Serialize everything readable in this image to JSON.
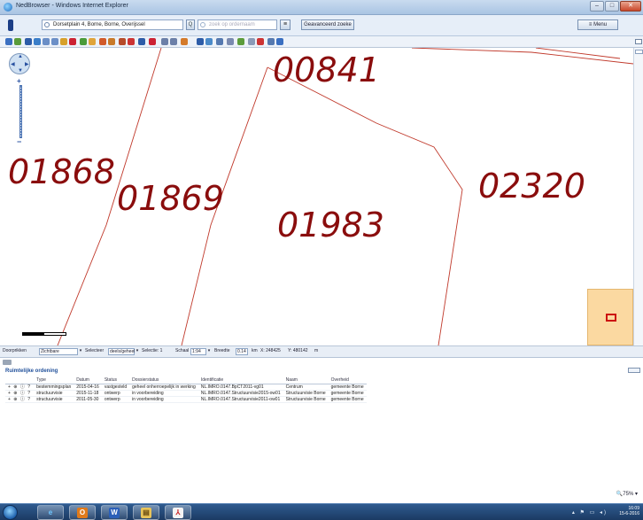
{
  "window": {
    "title": "NedBrowser - Windows Internet Explorer",
    "minimize": "–",
    "maximize": "□",
    "close": "✕"
  },
  "addressbar": {
    "address_value": "Dorsetplain 4, Borne, Borne, Overijssel",
    "search_button": "Q",
    "order_placeholder": "zoek op ordernaam",
    "list_button": "≡",
    "advanced_search": "Geavanceerd zoeke",
    "menu": "≡ Menu"
  },
  "map": {
    "parcels": [
      "00841",
      "01868",
      "01869",
      "01983",
      "02320"
    ],
    "nav_arrows": [
      "▲",
      "◀",
      "▶",
      "▼"
    ],
    "zoom_in": "+",
    "zoom_out": "−"
  },
  "statusbar": {
    "doorprikken_label": "Doorprikken",
    "doorprikken_value": "Zichtbare",
    "selecteer_label": "Selecteer",
    "selecteer_value": "deels/geheel",
    "selectie_label": "Selectie: 1",
    "schaal_label": "Schaal",
    "schaal_value": "1:94",
    "breedte_label": "Breedte",
    "breedte_value": "0.14",
    "unit_km": "km",
    "x_coord": "X: 248425",
    "y_coord": "Y: 480142",
    "unit_m": "m"
  },
  "ordening": {
    "title": "Ruimtelijke ordening",
    "columns": [
      "Type",
      "Datum",
      "Status",
      "Dossierstatus",
      "Identificatie",
      "Naam",
      "Overheid"
    ],
    "rows": [
      [
        "bestemmingsplan",
        "2015-04-16",
        "vastgesteld",
        "geheel onherroepelijk in werking",
        "NL.IMRO.0147.BpCT2011-vg01",
        "Centrum",
        "gemeente Borne"
      ],
      [
        "structuurvisie",
        "2015-11-18",
        "ontwerp",
        "in voorbereiding",
        "NL.IMRO.0147.Structuurvisie2015-ow01",
        "Structuurvisie Borne",
        "gemeente Borne"
      ],
      [
        "structuurvisie",
        "2011-05-30",
        "ontwerp",
        "in voorbereiding",
        "NL.IMRO.0147.Structuurvisie2011-ow01",
        "Structuurvisie Borne",
        "gemeente Borne"
      ]
    ],
    "row_icons": "+ ⊕ ⓘ ?"
  },
  "zoom_level": "🔍75%  ▾",
  "taskbar": {
    "ie_glyph": "e",
    "outlook_glyph": "O",
    "word_glyph": "W",
    "explorer_glyph": "▤",
    "pdf_glyph": "⅄",
    "clock_time": "16:09",
    "clock_date": "15-6-2016",
    "tray": "▴ ⚑ ▭ ◂)"
  },
  "colors": {
    "parcel_text": "#8a0d0d",
    "parcel_line": "#c0392b",
    "overview_fill": "#fbd9a1"
  }
}
